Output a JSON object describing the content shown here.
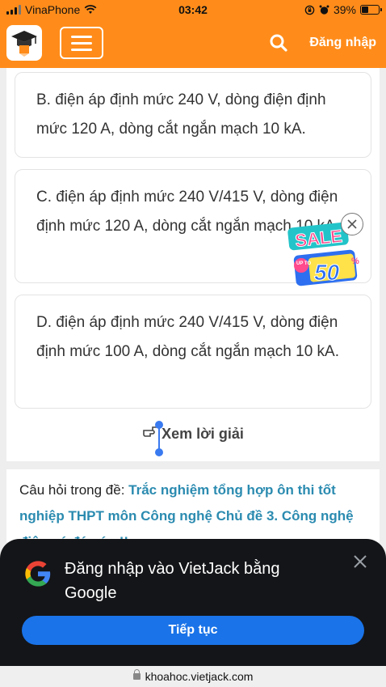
{
  "status_bar": {
    "carrier": "VinaPhone",
    "time": "03:42",
    "battery_percent": "39%",
    "battery_level": 0.39
  },
  "header": {
    "login_label": "Đăng nhập",
    "accent_color": "#ff8c1a"
  },
  "options": [
    {
      "text": "B. điện áp định mức 240 V, dòng điện định mức 120 A, dòng cắt ngắn mạch 10 kA."
    },
    {
      "text": "C. điện áp định mức 240 V/415 V, dòng điện định mức 120 A, dòng cắt ngắn mạch 10 kA."
    },
    {
      "text": "D. điện áp định mức 240 V/415 V, dòng điện định mức 100 A, dòng cắt ngắn mạch 10 kA."
    }
  ],
  "solution_link": "Xem lời giải",
  "sale_badge": {
    "sale_text": "SALE",
    "up_to_text": "UP TO",
    "percent_value": "50",
    "percent_sign": "%"
  },
  "question_source": {
    "prefix": "Câu hỏi trong đề: ",
    "link_text": "Trắc nghiệm tổng hợp ôn thi tốt nghiệp THPT môn Công nghệ Chủ đề 3. Công nghệ điện có đáp án !!"
  },
  "google_prompt": {
    "title": "Đăng nhập vào VietJack bằng Google",
    "continue_label": "Tiếp tục",
    "button_color": "#1a73e8"
  },
  "url_bar": {
    "domain": "khoahoc.vietjack.com"
  }
}
